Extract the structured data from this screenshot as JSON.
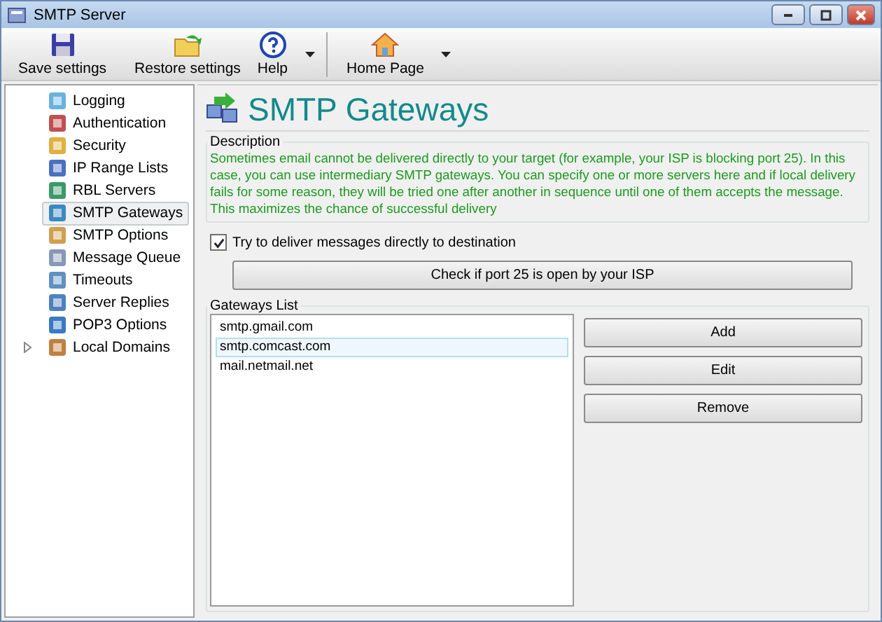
{
  "window": {
    "title": "SMTP Server"
  },
  "toolbar": [
    {
      "label": "Save settings",
      "kind": "save",
      "dropdown": false
    },
    {
      "label": "Restore settings",
      "kind": "restore",
      "dropdown": false
    },
    {
      "label": "Help",
      "kind": "help",
      "dropdown": true
    },
    {
      "label": "Home Page",
      "kind": "home",
      "dropdown": true
    }
  ],
  "sidebar": {
    "items": [
      {
        "label": "Logging",
        "selected": false,
        "expandable": false
      },
      {
        "label": "Authentication",
        "selected": false,
        "expandable": false
      },
      {
        "label": "Security",
        "selected": false,
        "expandable": false
      },
      {
        "label": "IP Range Lists",
        "selected": false,
        "expandable": false
      },
      {
        "label": "RBL Servers",
        "selected": false,
        "expandable": false
      },
      {
        "label": "SMTP Gateways",
        "selected": true,
        "expandable": false
      },
      {
        "label": "SMTP Options",
        "selected": false,
        "expandable": false
      },
      {
        "label": "Message Queue",
        "selected": false,
        "expandable": false
      },
      {
        "label": "Timeouts",
        "selected": false,
        "expandable": false
      },
      {
        "label": "Server Replies",
        "selected": false,
        "expandable": false
      },
      {
        "label": "POP3 Options",
        "selected": false,
        "expandable": false
      },
      {
        "label": "Local Domains",
        "selected": false,
        "expandable": true
      }
    ]
  },
  "page": {
    "title": "SMTP Gateways",
    "description": {
      "label": "Description",
      "text": "Sometimes email cannot be delivered directly to your target (for example, your ISP is blocking port 25). In this case, you can use intermediary SMTP gateways. You can specify one or more servers here and if local delivery fails for some reason, they will be tried one after another in sequence until one of them accepts the message. This maximizes the chance of successful delivery"
    },
    "direct_delivery": {
      "label": "Try to deliver messages directly to destination",
      "checked": true
    },
    "check_button": "Check if port 25 is open by your ISP",
    "gateways": {
      "label": "Gateways List",
      "items": [
        {
          "label": "smtp.gmail.com",
          "selected": false
        },
        {
          "label": "smtp.comcast.com",
          "selected": true
        },
        {
          "label": "mail.netmail.net",
          "selected": false
        }
      ],
      "buttons": [
        "Add",
        "Edit",
        "Remove"
      ]
    }
  }
}
